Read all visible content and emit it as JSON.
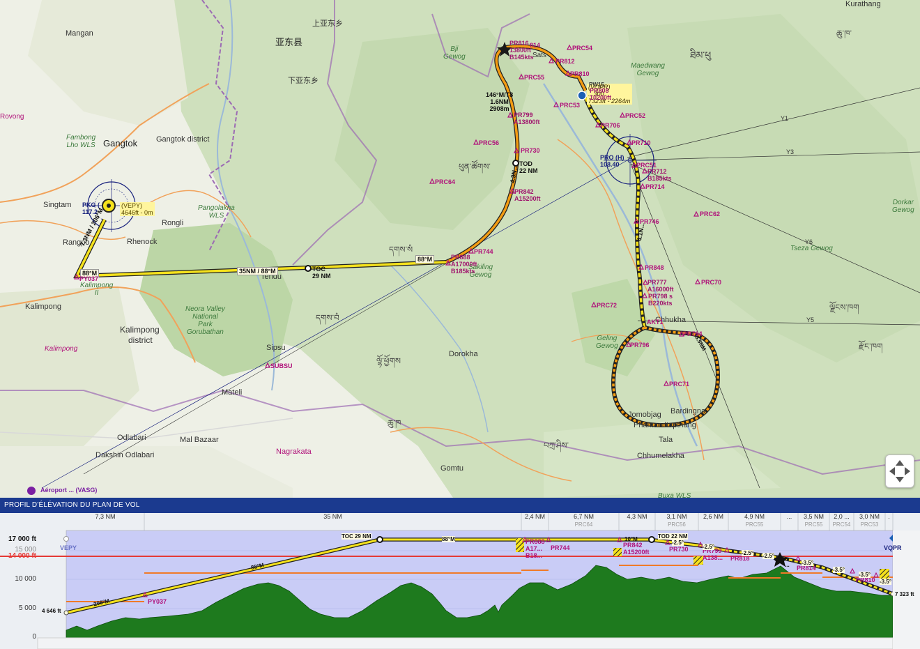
{
  "places": {
    "mangan": "Mangan",
    "yadong": "亚东县",
    "shangyadong": "上亚东乡",
    "xiayadong": "下亚东乡",
    "rovong": "Rovong",
    "gangtok": "Gangtok",
    "gangtok_district": "Gangtok district",
    "fambong_1": "Fambong",
    "fambong_2": "Lho WLS",
    "singtam": "Singtam",
    "rangpo": "Rangpo",
    "rongli": "Rongli",
    "rhenock": "Rhenock",
    "pangolakha_1": "Pangolakha",
    "pangolakha_2": "WLS",
    "kalimpong_ii_1": "Kalimpong",
    "kalimpong_ii_2": "II",
    "kalimpong": "Kalimpong",
    "kalimpong_district_1": "Kalimpong",
    "kalimpong_district_2": "district",
    "kalimpong_small": "Kalimpong",
    "tendu": "Tendu",
    "neora_1": "Neora Valley",
    "neora_2": "National",
    "neora_3": "Park",
    "neora_4": "Gorubathan",
    "sipsu": "Sipsu",
    "mateli": "Mateli",
    "odlabari": "Odlabari",
    "mal_bazaar": "Mal Bazaar",
    "dakshin": "Dakshin Odlabari",
    "nagrakata": "Nagrakata",
    "dorokha": "Dorokha",
    "gomtu": "Gomtu",
    "bji_1": "Bji",
    "bji_2": "Gewog",
    "sang_1": "Sa",
    "sang_2": "kiling",
    "sang_3": "Gewog",
    "maedwang_1": "Maedwang",
    "maedwang_2": "Gewog",
    "geling_1": "Geling",
    "geling_2": "Gewog",
    "dorkar_1": "Dorkar",
    "dorkar_2": "Gewog",
    "tseza": "Tseza Gewog",
    "chhukha": "Chhukha",
    "jomobjag": "Jomobjag",
    "bardingna": "Bardingna",
    "phamaedtapthang": "Phamaedtapthang",
    "tala": "Tala",
    "chhumelakha": "Chhumelakha",
    "buxa": "Buxa WLS",
    "kurathang": "Kurathang",
    "thimphu_script": "ཐིམ་ཕུ",
    "dz1": "ཆུ་ཁ་",
    "dz2": "དགས་སཾ",
    "dz3": "དགས་བཾ",
    "dz4": "ཕུན་ཚོགས་",
    "dz5": "ལྗོངས་ཁག",
    "dz6": "རྫོང་ཁག",
    "dz7": "ཆུ་ཁ",
    "dz8": "བཀྲ་ཤིས་",
    "dz9": "ལྷོ་ཕྱོགས",
    "sats": "Sats"
  },
  "waypoints": {
    "py037": "PY037",
    "subsu": "SUBSU",
    "pr888": "PR888",
    "pr888_alt": "A17000ft",
    "pr888_spd": "B185kts",
    "pr744": "PR744",
    "pr842": "PR842",
    "pr842_alt": "A15200ft",
    "pr730": "PR730",
    "pr799": "PR799",
    "pr799_alt": "A13800ft",
    "pr816": "PR816",
    "pr816_alt": "13800ft",
    "pr816_spd": "B145kts",
    "pr814": "814",
    "pr812": "PR812",
    "pr810": "PR810",
    "pr808": "PR808",
    "pr808_alt": "10200ft",
    "pr706": "PR706",
    "pr710": "PR710",
    "pr712": "PR712",
    "pr712_spd": "B185kts",
    "pr714": "PR714",
    "pr746": "PR746",
    "pr848": "PR848",
    "pr777": "PR777",
    "pr777_alt": "A16000ft",
    "pr798": "PR798 s",
    "pr798_spd": "B220kts",
    "pr794": "PR794",
    "pr796": "PR796",
    "prc54": "PRC54",
    "prc55": "PRC55",
    "prc53": "PRC53",
    "prc52": "PRC52",
    "prc56": "PRC56",
    "prc64": "PRC64",
    "prc51": "PRC51",
    "prc62": "PRC62",
    "prc70": "PRC70",
    "prc72": "PRC72",
    "prc71": "PRC71",
    "pr_akt": "AKT1",
    "pw15": "PW15"
  },
  "legs": {
    "leg1": "7.3NM / 206°M",
    "leg1_brg": "88°M",
    "leg2": "35NM / 88°M",
    "toc": "TOC",
    "toc_dist": "29 NM",
    "leg3_brg": "88°M",
    "tod": "TOD",
    "tod_dist": "22 NM",
    "leg4": "4.3N...",
    "leg5_1": "146°M/T8",
    "leg5_2": "1.6NM",
    "leg5_3": "2908m",
    "leg6": "4.1N...",
    "leg7": "5.9NM"
  },
  "navaids": {
    "pkg_1": "PKG (",
    "pkg_2": "117.2",
    "pro_1": "PRO (H)",
    "pro_2": "108.40"
  },
  "airports": {
    "vepy_1": "(VEPY)",
    "vepy_2": "4646ft - 0m",
    "vopr_1": "(VQPR)",
    "vopr_2": "...300",
    "vopr_3": "7323ft - 2264m",
    "vasg": "Aéroport ... (VASG)"
  },
  "airways": {
    "y1": "Y1",
    "y3": "Y3",
    "y6": "Y6",
    "y5": "Y5"
  },
  "profile": {
    "title": "PROFIL D'ÉLÉVATION DU PLAN DE VOL",
    "segments": [
      {
        "dist": "7,3 NM",
        "name": ""
      },
      {
        "dist": "35 NM",
        "name": ""
      },
      {
        "dist": "2,4 NM",
        "name": ""
      },
      {
        "dist": "6,7 NM",
        "name": "PRC64"
      },
      {
        "dist": "4,3 NM",
        "name": ""
      },
      {
        "dist": "3,1 NM",
        "name": "PRC56"
      },
      {
        "dist": "2,6 NM",
        "name": ""
      },
      {
        "dist": "4,9 NM",
        "name": "PRC55"
      },
      {
        "dist": "...",
        "name": ""
      },
      {
        "dist": "3,5 NM",
        "name": "PRC55"
      },
      {
        "dist": "2,0 ...",
        "name": "PRC54"
      },
      {
        "dist": "3,0 NM",
        "name": "PRC53"
      },
      {
        "dist": ".",
        "name": ""
      }
    ],
    "y_17000": "17 000 ft",
    "y_15000": "15 000",
    "y_14000": "14 000 ft",
    "y_10000": "10 000",
    "y_5000": "5 000",
    "y_0": "0",
    "dep": "VEPY",
    "arr": "VQPR",
    "dep_elev": "4 646 ft",
    "arr_elev": "7 323 ft",
    "toc": "TOC 29 NM",
    "tod": "TOD 22 NM",
    "brg_climb1": "206°M",
    "brg_climb2": "88°M",
    "brg_cruise": "88°M",
    "brg_10": "10°M",
    "py037": "PY037",
    "pr888": "PR888",
    "pr888_alt": "A17...",
    "pr888_spd": "B18...",
    "pr744": "PR744",
    "pr842": "PR842",
    "pr842_alt": "A15200ft",
    "pr730": "PR730",
    "pr799": "PR799",
    "pr799_alt": "A138...",
    "pr818": "PR818",
    "pr814": "PR814",
    "pr810": "PR810",
    "slope1": "-2.5°",
    "slope2": "-2.5°",
    "slope3": "-2.5°",
    "slope4": "-2.5°",
    "slope5": "-3.5°",
    "slope6": "-3.5°",
    "slope7": "-3.5°",
    "slope8": "-3.5°",
    "dots": "..."
  },
  "colors": {
    "route": "#f5e21c",
    "route_edge": "#222222",
    "approach": "#f39c12",
    "waypoint": "#b0117a",
    "profile_bg": "#c9ccf6",
    "terrain": "#1e7a1e",
    "min_alt_line": "#e53935",
    "header": "#1b3a8f"
  }
}
